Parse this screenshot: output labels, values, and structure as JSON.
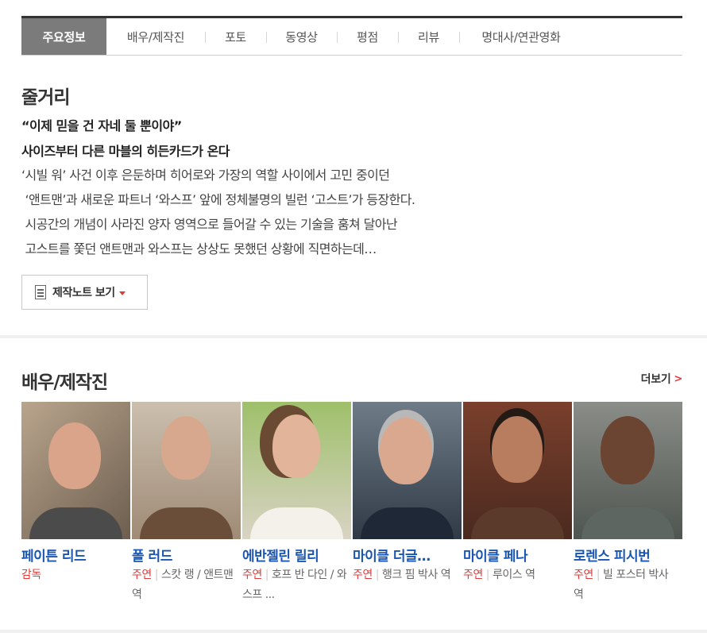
{
  "tabs": [
    {
      "label": "주요정보",
      "active": true
    },
    {
      "label": "배우/제작진"
    },
    {
      "label": "포토"
    },
    {
      "label": "동영상"
    },
    {
      "label": "평점"
    },
    {
      "label": "리뷰"
    },
    {
      "label": "명대사/연관영화"
    }
  ],
  "synopsis": {
    "heading": "줄거리",
    "tagline1": "“이제 믿을 건 자네 둘 뿐이야”",
    "tagline2": "사이즈부터 다른 마블의 히든카드가 온다",
    "lines": [
      "‘시빌 워’ 사건 이후 은둔하며 히어로와 가장의 역할 사이에서 고민 중이던",
      " ‘앤트맨’과 새로운 파트너 ‘와스프’ 앞에 정체불명의 빌런 ‘고스트’가 등장한다.",
      " 시공간의 개념이 사라진 양자 영역으로 들어갈 수 있는 기술을 훔쳐 달아난",
      " 고스트를 쫓던 앤트맨과 와스프는 상상도 못했던 상황에 직면하는데…"
    ],
    "note_button": "제작노트 보기"
  },
  "cast_section": {
    "heading": "배우/제작진",
    "more_label": "더보기",
    "members": [
      {
        "name": "페이튼 리드",
        "type": "감독",
        "role": ""
      },
      {
        "name": "폴 러드",
        "type": "주연",
        "role": "스캇 랭 / 앤트맨 역"
      },
      {
        "name": "에반젤린 릴리",
        "type": "주연",
        "role": "호프 반 다인 / 와스프 ..."
      },
      {
        "name": "마이클 더글…",
        "type": "주연",
        "role": "행크 핌 박사 역"
      },
      {
        "name": "마이클 페나",
        "type": "주연",
        "role": "루이스 역"
      },
      {
        "name": "로렌스 피시번",
        "type": "주연",
        "role": "빌 포스터 박사 역"
      }
    ]
  },
  "colors": {
    "accent_red": "#e03a3a",
    "link_blue": "#1a56b0",
    "tab_active_bg": "#7b7b7b"
  }
}
